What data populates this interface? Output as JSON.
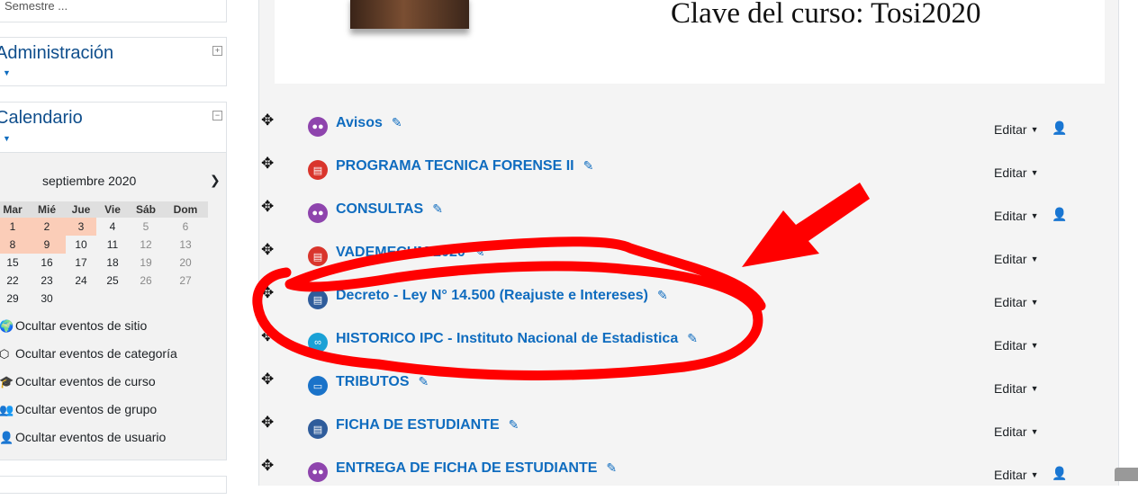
{
  "sidebar": {
    "top_block_text": "Semestre ...",
    "admin": {
      "title": "Administración",
      "toggle": "+"
    },
    "calendar": {
      "title": "Calendario",
      "toggle": "−",
      "month": "septiembre 2020",
      "next": "❯",
      "weekdays": [
        "Mar",
        "Mié",
        "Jue",
        "Vie",
        "Sáb",
        "Dom"
      ],
      "weeks": [
        [
          "1",
          "2",
          "3",
          "4",
          "5",
          "6"
        ],
        [
          "8",
          "9",
          "10",
          "11",
          "12",
          "13"
        ],
        [
          "15",
          "16",
          "17",
          "18",
          "19",
          "20"
        ],
        [
          "22",
          "23",
          "24",
          "25",
          "26",
          "27"
        ],
        [
          "29",
          "30",
          "",
          "",
          "",
          ""
        ]
      ],
      "event_filters": [
        {
          "label": "Ocultar eventos de sitio",
          "icon": "globe-icon",
          "glyph": "🌍"
        },
        {
          "label": "Ocultar eventos de categoría",
          "icon": "cubes-icon",
          "glyph": "⬡"
        },
        {
          "label": "Ocultar eventos de curso",
          "icon": "graduation-cap-icon",
          "glyph": "🎓"
        },
        {
          "label": "Ocultar eventos de grupo",
          "icon": "users-icon",
          "glyph": "👥"
        },
        {
          "label": "Ocultar eventos de usuario",
          "icon": "user-icon",
          "glyph": "👤"
        }
      ]
    }
  },
  "banner": {
    "text": "Clave del curso: Tosi2020"
  },
  "activities": [
    {
      "name": "Avisos",
      "type": "forum",
      "edit": "Editar",
      "role_icon": true
    },
    {
      "name": "PROGRAMA TECNICA FORENSE II",
      "type": "pdf",
      "edit": "Editar",
      "role_icon": false
    },
    {
      "name": "CONSULTAS",
      "type": "forum",
      "edit": "Editar",
      "role_icon": true
    },
    {
      "name": "VADEMECUM 2020",
      "type": "pdf",
      "edit": "Editar",
      "role_icon": false
    },
    {
      "name": "Decreto - Ley N° 14.500 (Reajuste e Intereses)",
      "type": "page",
      "edit": "Editar",
      "role_icon": false
    },
    {
      "name": "HISTORICO IPC - Instituto Nacional de Estadistica",
      "type": "url",
      "edit": "Editar",
      "role_icon": false
    },
    {
      "name": "TRIBUTOS",
      "type": "folder",
      "edit": "Editar",
      "role_icon": false
    },
    {
      "name": "FICHA DE ESTUDIANTE",
      "type": "page",
      "edit": "Editar",
      "role_icon": false
    },
    {
      "name": "ENTREGA DE FICHA DE ESTUDIANTE",
      "type": "forum",
      "edit": "Editar",
      "role_icon": true
    }
  ],
  "colors": {
    "link": "#0f6cbf",
    "annotation": "#ff0000",
    "highlight_day": "#fbcdb8"
  }
}
